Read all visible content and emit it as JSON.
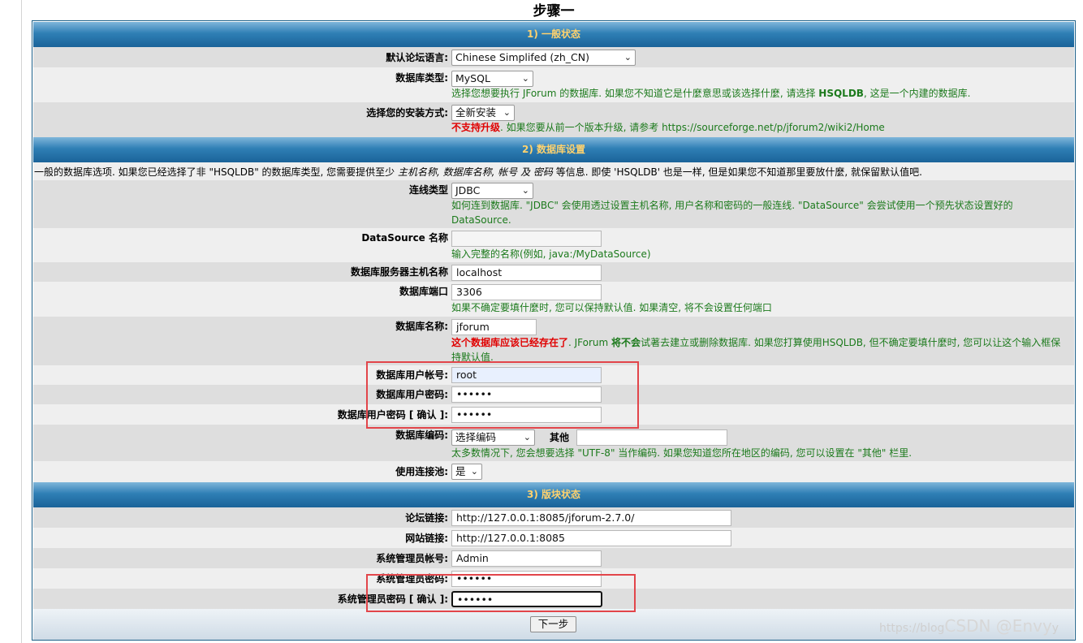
{
  "page_title": "步骤一",
  "sections": {
    "general": "1) 一般状态",
    "database": "2) 数据库设置",
    "forum": "3) 版块状态"
  },
  "general": {
    "language_label": "默认论坛语言:",
    "language_value": "Chinese Simplifed (zh_CN)",
    "dbtype_label": "数据库类型:",
    "dbtype_value": "MySQL",
    "dbtype_help_1": "选择您想要执行 JForum 的数据库. 如果您不知道它是什麼意思或该选择什麼, 请选择 ",
    "dbtype_help_hsqldb": "HSQLDB",
    "dbtype_help_2": ", 这是一个内建的数据库.",
    "install_label": "选择您的安装方式:",
    "install_value": "全新安装",
    "install_note_red": "不支持升级",
    "install_note": ". 如果您要从前一个版本升级, 请参考 https://sourceforge.net/p/jforum2/wiki2/Home"
  },
  "database": {
    "intro_1": "一般的数据库选项. 如果您已经选择了非 \"HSQLDB\" 的数据库类型, 您需要提供至少 ",
    "intro_fields": "主机名称, 数据库名称, 帐号 及 密码",
    "intro_2": " 等信息. 即使 'HSQLDB' 也是一样, 但是如果您不知道那里要放什麼, 就保留默认值吧.",
    "conn_label": "连线类型",
    "conn_value": "JDBC",
    "conn_help": "如何连到数据库. \"JDBC\" 会使用透过设置主机名称, 用户名称和密码的一般连线. \"DataSource\" 会尝试使用一个预先状态设置好的DataSource.",
    "ds_label": "DataSource 名称",
    "ds_value": "",
    "ds_help": "输入完整的名称(例如, java:/MyDataSource)",
    "host_label": "数据库服务器主机名称",
    "host_value": "localhost",
    "port_label": "数据库端口",
    "port_value": "3306",
    "port_help": "如果不确定要填什麼时, 您可以保持默认值. 如果清空, 将不会设置任何端口",
    "dbname_label": "数据库名称:",
    "dbname_value": "jforum",
    "dbname_help_red": "这个数据库应该已经存在了",
    "dbname_help_1": ". JForum ",
    "dbname_help_strong": "将不会",
    "dbname_help_2": "试著去建立或删除数据库. 如果您打算使用HSQLDB, 但不确定要填什麼时, 您可以让这个输入框保持默认值.",
    "user_label": "数据库用户帐号:",
    "user_value": "root",
    "pass_label": "数据库用户密码:",
    "pass_value": "••••••",
    "pass2_label": "数据库用户密码 [ 确认 ]:",
    "pass2_value": "••••••",
    "enc_label": "数据库编码:",
    "enc_value": "选择编码",
    "enc_other_label": "其他",
    "enc_other_value": "",
    "enc_help": "太多数情况下, 您会想要选择 \"UTF-8\" 当作编码. 如果您知道您所在地区的编码, 您可以设置在 \"其他\" 栏里.",
    "pool_label": "使用连接池:",
    "pool_value": "是"
  },
  "forum": {
    "link_label": "论坛链接:",
    "link_value": "http://127.0.0.1:8085/jforum-2.7.0/",
    "site_label": "网站链接:",
    "site_value": "http://127.0.0.1:8085",
    "admin_label": "系统管理员帐号:",
    "admin_value": "Admin",
    "apass_label": "系统管理员密码:",
    "apass_value": "••••••",
    "apass2_label": "系统管理员密码 [ 确认 ]:",
    "apass2_value": "••••••"
  },
  "next_button": "下一步",
  "watermark": {
    "prefix": "https://blog",
    "brand": "CSDN @Envy",
    "suffix": "y"
  },
  "colors": {
    "band": "#2f7fb5",
    "band_text": "#ffd26e",
    "help_text": "#1c7a1c",
    "warning_text": "#e00000",
    "highlight_box": "#e2454a"
  },
  "icons": {
    "select_arrow": "chevron-down-icon"
  }
}
